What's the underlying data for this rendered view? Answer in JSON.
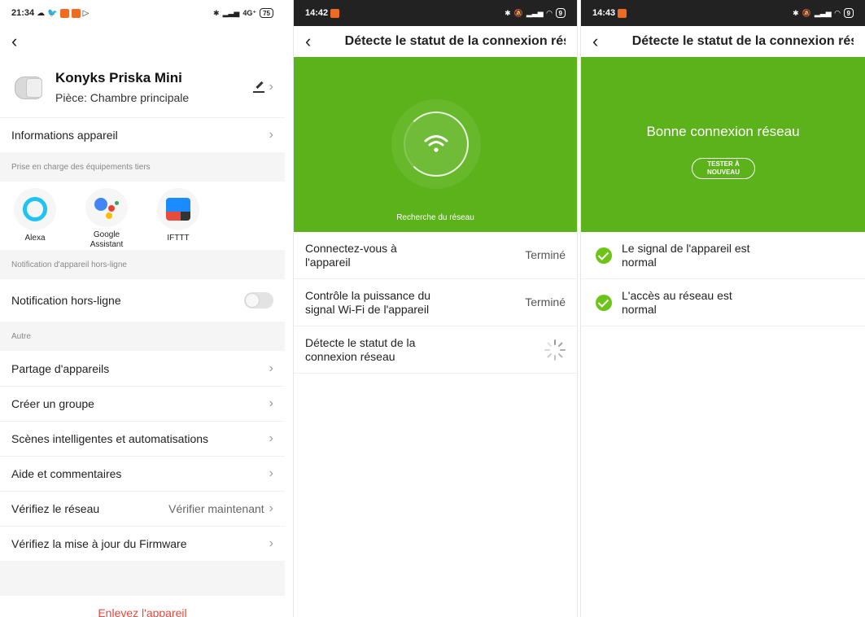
{
  "screen1": {
    "status": {
      "time": "21:34",
      "right_text": "4G⁺",
      "battery": "75"
    },
    "device": {
      "name": "Konyks Priska Mini",
      "room": "Pièce: Chambre principale"
    },
    "info_row": "Informations appareil",
    "tiers_header": "Prise en charge des équipements tiers",
    "tiers": [
      {
        "label": "Alexa"
      },
      {
        "label": "Google Assistant"
      },
      {
        "label": "IFTTT"
      }
    ],
    "offline_header": "Notification d'appareil hors-ligne",
    "offline_row": "Notification hors-ligne",
    "other_header": "Autre",
    "menu": [
      {
        "label": "Partage d'appareils"
      },
      {
        "label": "Créer un groupe"
      },
      {
        "label": "Scènes intelligentes et automatisations"
      },
      {
        "label": "Aide et commentaires"
      },
      {
        "label": "Vérifiez le réseau",
        "value": "Vérifier maintenant"
      },
      {
        "label": "Vérifiez la mise à jour du Firmware"
      }
    ],
    "remove": "Enlevez l'appareil"
  },
  "screen2": {
    "status": {
      "time": "14:42",
      "battery": "9"
    },
    "title": "Détecte le statut de la connexion rés…",
    "caption": "Recherche du réseau",
    "steps": [
      {
        "label": "Connectez-vous à l'appareil",
        "status": "Terminé"
      },
      {
        "label": "Contrôle la puissance du signal Wi-Fi de l'appareil",
        "status": "Terminé"
      },
      {
        "label": "Détecte le statut de la connexion réseau",
        "status": ""
      }
    ]
  },
  "screen3": {
    "status": {
      "time": "14:43",
      "battery": "9"
    },
    "title": "Détecte le statut de la connexion rés…",
    "hero_title": "Bonne connexion réseau",
    "retest": "TESTER À NOUVEAU",
    "results": [
      {
        "label": "Le signal de l'appareil est normal"
      },
      {
        "label": "L'accès au réseau est normal"
      }
    ]
  },
  "colors": {
    "green": "#5cb21b",
    "check_green": "#6cc418",
    "danger": "#e8473c",
    "status_dark": "#222222"
  }
}
